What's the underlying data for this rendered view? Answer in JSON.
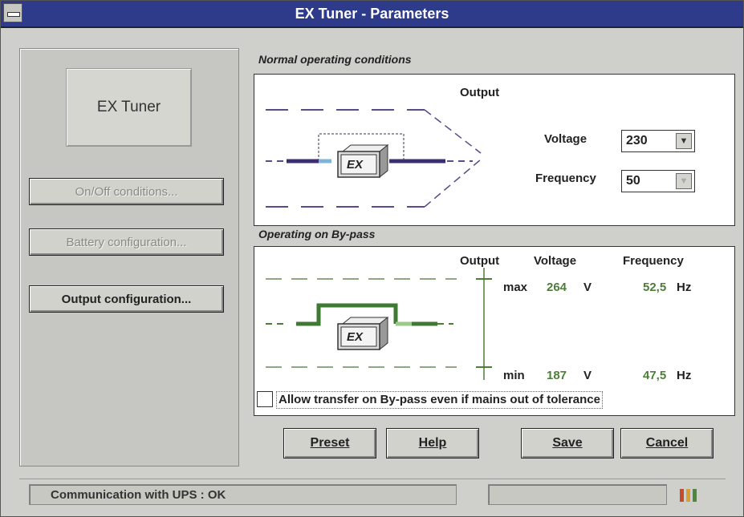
{
  "window": {
    "title": "EX Tuner - Parameters"
  },
  "left": {
    "logo": "EX Tuner",
    "on_off_label": "On/Off conditions...",
    "battery_label": "Battery configuration...",
    "output_label": "Output configuration..."
  },
  "normal": {
    "section_title": "Normal operating conditions",
    "output_label": "Output",
    "voltage_label": "Voltage",
    "voltage_value": "230",
    "frequency_label": "Frequency",
    "frequency_value": "50",
    "ex_label": "EX"
  },
  "bypass": {
    "section_title": "Operating on By-pass",
    "col_output": "Output",
    "col_voltage": "Voltage",
    "col_frequency": "Frequency",
    "max_label": "max",
    "max_voltage": "264",
    "max_voltage_unit": "V",
    "max_frequency": "52,5",
    "max_frequency_unit": "Hz",
    "min_label": "min",
    "min_voltage": "187",
    "min_voltage_unit": "V",
    "min_frequency": "47,5",
    "min_frequency_unit": "Hz",
    "ex_label": "EX",
    "allow_transfer_label": "Allow transfer on By-pass even if mains out of tolerance"
  },
  "buttons": {
    "preset": "Preset",
    "help": "Help",
    "save": "Save",
    "cancel": "Cancel"
  },
  "status": {
    "communication": "Communication with UPS : OK"
  },
  "colors": {
    "title_bar": "#2e3a8a",
    "green": "#4d7d3a",
    "purple_line": "#5a4a8a"
  }
}
